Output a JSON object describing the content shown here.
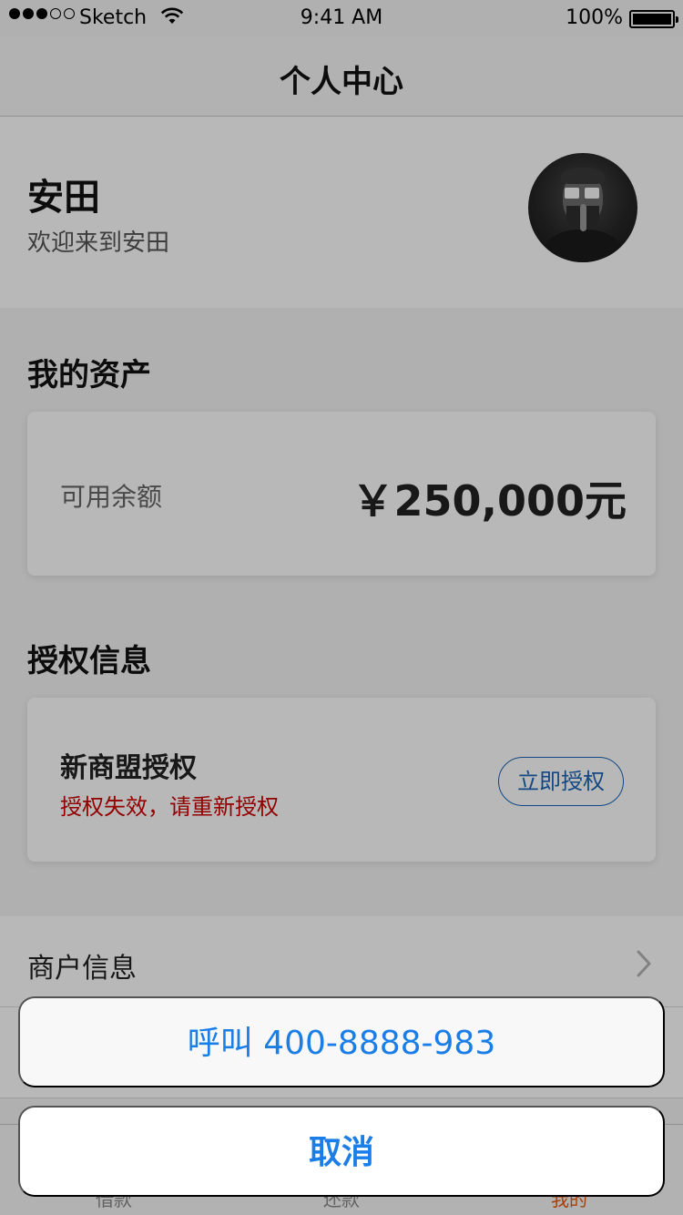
{
  "status_bar": {
    "carrier": "Sketch",
    "time": "9:41 AM",
    "battery": "100%"
  },
  "nav": {
    "title": "个人中心"
  },
  "profile": {
    "name": "安田",
    "welcome": "欢迎来到安田"
  },
  "assets": {
    "title": "我的资产",
    "balance_label": "可用余额",
    "balance_value": "￥250,000元"
  },
  "authorization": {
    "title": "授权信息",
    "merchant": "新商盟授权",
    "status": "授权失效，请重新授权",
    "button": "立即授权"
  },
  "list": {
    "merchant_info": "商户信息"
  },
  "tabs": [
    {
      "label": "借款",
      "active": false
    },
    {
      "label": "还款",
      "active": false
    },
    {
      "label": "我的",
      "active": true
    }
  ],
  "action_sheet": {
    "call_label": "呼叫 400-8888-983",
    "cancel_label": "取消"
  },
  "colors": {
    "accent_blue": "#1a7ee6",
    "error_red": "#cc0000",
    "active_tab": "#e8590c"
  },
  "icons": [
    "wifi-icon",
    "battery-icon",
    "chevron-right-icon",
    "avatar-photo"
  ]
}
